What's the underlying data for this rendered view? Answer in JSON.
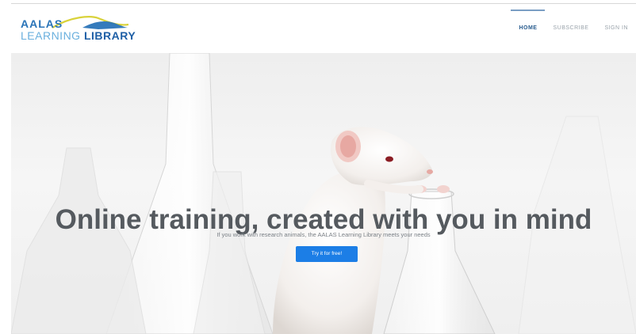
{
  "logo": {
    "line1": "AALAS",
    "line2_light": "LEARNING",
    "line2_dark": "LIBRARY"
  },
  "nav": {
    "items": [
      {
        "label": "HOME",
        "active": true
      },
      {
        "label": "SUBSCRIBE",
        "active": false
      },
      {
        "label": "SIGN IN",
        "active": false
      }
    ]
  },
  "hero": {
    "headline": "Online training, created with you in mind",
    "subline": "If you work with research animals, the AALAS Learning Library meets your needs",
    "cta_label": "Try it for free!"
  },
  "colors": {
    "brand_blue": "#2a74b8",
    "cta_blue": "#1c7ee6",
    "swoosh_yellow": "#d9d23a"
  }
}
